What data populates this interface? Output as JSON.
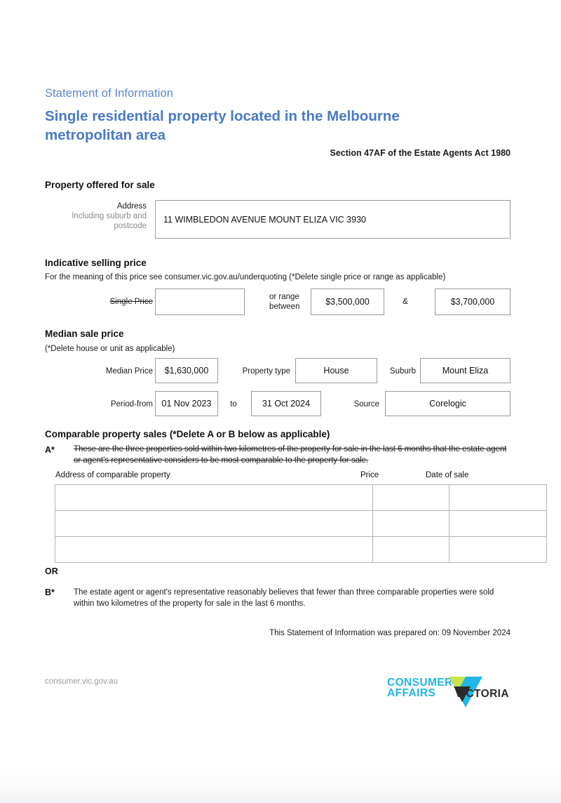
{
  "document": {
    "kicker": "Statement of Information",
    "title": "Single residential property located in the Melbourne metropolitan area",
    "section_reference": "Section 47AF of the Estate Agents Act 1980"
  },
  "property_offered": {
    "heading": "Property offered for sale",
    "address_label": "Address",
    "address_hint": "Including suburb and postcode",
    "address_value": "11 WIMBLEDON AVENUE MOUNT ELIZA VIC 3930"
  },
  "indicative_price": {
    "heading": "Indicative selling price",
    "note": "For the meaning of this price see consumer.vic.gov.au/underquoting (*Delete single price or range as applicable)",
    "single_price_label": "Single Price",
    "single_price_value": "",
    "or_range_label": "or range between",
    "range_low": "$3,500,000",
    "ampersand": "&",
    "range_high": "$3,700,000"
  },
  "median_price": {
    "heading": "Median sale price",
    "note": "(*Delete house or unit as applicable)",
    "median_price_label": "Median Price",
    "median_price_value": "$1,630,000",
    "property_type_label": "Property type",
    "property_type_value": "House",
    "suburb_label": "Suburb",
    "suburb_value": "Mount Eliza",
    "period_from_label": "Period-from",
    "period_from_value": "01 Nov 2023",
    "to_label": "to",
    "period_to_value": "31 Oct 2024",
    "source_label": "Source",
    "source_value": "Corelogic"
  },
  "comparable_sales": {
    "heading": "Comparable property sales (*Delete A or B below as applicable)",
    "option_a_letter": "A*",
    "option_a_text": "These are the three properties sold within two kilometres of the property for sale in the last 6 months that the estate agent or agent's representative considers to be most comparable to the property for sale.",
    "columns": [
      "Address of comparable property",
      "Price",
      "Date of sale"
    ],
    "rows": [
      {
        "address": "",
        "price": "",
        "date": ""
      },
      {
        "address": "",
        "price": "",
        "date": ""
      },
      {
        "address": "",
        "price": "",
        "date": ""
      }
    ],
    "or_label": "OR",
    "option_b_letter": "B*",
    "option_b_text": "The estate agent or agent's representative reasonably believes that fewer than three comparable properties were sold within two kilometres of the property for sale in the last 6 months."
  },
  "prepared_line": "This Statement of Information was prepared on: 09 November 2024",
  "footer": {
    "url": "consumer.vic.gov.au",
    "logo_line1": "CONSUMER",
    "logo_line2": "AFFAIRS",
    "logo_line3": "VICTORIA"
  },
  "colors": {
    "heading_blue": "#4a7ac7",
    "kicker_blue": "#5b87d0",
    "logo_cyan": "#1fb6e8",
    "logo_green": "#c6e54a",
    "logo_dark": "#2a2a2a",
    "box_border": "#9a9a9a",
    "table_border": "#b4b4b4"
  }
}
